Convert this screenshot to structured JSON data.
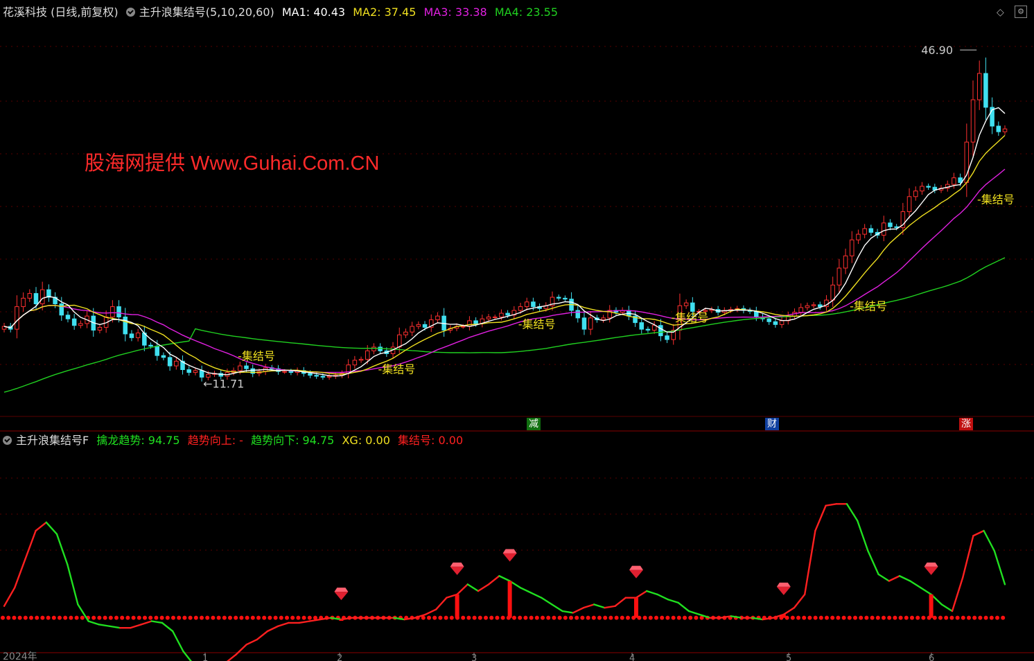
{
  "header": {
    "title": "花溪科技 (日线,前复权)",
    "indicator_name": "主升浪集结号(5,10,20,60)",
    "ma": [
      {
        "label": "MA1: 40.43",
        "color": "#ffffff"
      },
      {
        "label": "MA2: 37.45",
        "color": "#f0e020"
      },
      {
        "label": "MA3: 33.38",
        "color": "#e020e0"
      },
      {
        "label": "MA4: 23.55",
        "color": "#20d020"
      }
    ]
  },
  "watermark": "股海网提供 Www.Guhai.Com.CN",
  "sub_header": {
    "name": "主升浪集结号F",
    "items": [
      {
        "label": "擒龙趋势: 94.75",
        "color": "#20e020"
      },
      {
        "label": "趋势向上: -",
        "color": "#ff2020"
      },
      {
        "label": "趋势向下: 94.75",
        "color": "#20e020"
      },
      {
        "label": "XG: 0.00",
        "color": "#f0e020"
      },
      {
        "label": "集结号: 0.00",
        "color": "#ff2020"
      }
    ]
  },
  "annotations": {
    "high_label": "46.90",
    "low_label": "11.71",
    "signal_text": "集结号",
    "event_tags": [
      {
        "text": "减",
        "bg": "#107010",
        "color": "#ffffff"
      },
      {
        "text": "财",
        "bg": "#1040a0",
        "color": "#ffffff"
      },
      {
        "text": "涨",
        "bg": "#c01010",
        "color": "#ffffff"
      }
    ]
  },
  "x_axis": {
    "year_label": "2024年",
    "month_labels": [
      "1",
      "2",
      "3",
      "4",
      "5",
      "6"
    ]
  },
  "icons": [
    "diamond-icon",
    "settings-icon"
  ],
  "chart_data": {
    "type": "candlestick",
    "main_panel": {
      "price_ylim": [
        8,
        50
      ],
      "high": 46.9,
      "low": 11.71,
      "ma_last": {
        "MA1": 40.43,
        "MA2": 37.45,
        "MA3": 33.38,
        "MA4": 23.55
      },
      "close": [
        17.5,
        17.2,
        19.6,
        20.5,
        21.0,
        19.9,
        21.4,
        20.6,
        19.9,
        18.7,
        18.3,
        17.6,
        17.8,
        18.6,
        17.1,
        17.4,
        18.5,
        19.6,
        18.5,
        16.7,
        16.3,
        16.8,
        15.5,
        15.4,
        14.4,
        14.2,
        13.3,
        13.8,
        12.9,
        12.6,
        12.8,
        12.1,
        12.4,
        12.5,
        12.2,
        12.6,
        12.8,
        13.3,
        13.0,
        12.5,
        12.7,
        13.1,
        13.0,
        12.7,
        12.7,
        12.6,
        12.8,
        12.5,
        12.3,
        12.2,
        12.1,
        12.2,
        12.3,
        12.5,
        13.4,
        13.9,
        14.0,
        14.9,
        15.3,
        14.9,
        14.6,
        15.3,
        16.6,
        16.9,
        17.5,
        17.7,
        17.4,
        18.2,
        18.6,
        17.1,
        17.3,
        17.5,
        17.5,
        18.1,
        17.8,
        18.3,
        18.5,
        18.5,
        18.9,
        18.7,
        19.2,
        19.6,
        20.1,
        19.6,
        19.4,
        19.7,
        20.6,
        20.5,
        20.4,
        19.2,
        18.4,
        17.2,
        18.4,
        18.2,
        18.4,
        19.2,
        19.0,
        19.2,
        18.6,
        17.9,
        17.2,
        17.1,
        17.6,
        16.5,
        16.1,
        17.1,
        19.7,
        20.0,
        19.1,
        19.1,
        19.2,
        19.3,
        19.0,
        19.2,
        19.3,
        19.4,
        19.2,
        19.1,
        18.5,
        18.3,
        18.0,
        17.7,
        18.1,
        18.6,
        19.0,
        19.5,
        19.7,
        19.8,
        19.6,
        20.3,
        21.9,
        23.7,
        25.0,
        26.7,
        27.3,
        27.9,
        27.5,
        27.2,
        28.5,
        28.1,
        28.0,
        29.7,
        31.3,
        31.9,
        32.4,
        32.3,
        32.0,
        32.2,
        32.6,
        33.3,
        32.8,
        37.1,
        41.6,
        44.4,
        40.8,
        38.8,
        38.2,
        38.5
      ]
    },
    "sub_panel": {
      "ylim": [
        -20,
        100
      ],
      "baseline": 0,
      "series": [
        {
          "name": "擒龙趋势",
          "values": [
            7,
            18,
            35,
            52,
            57,
            50,
            32,
            8,
            -2,
            -4,
            -5,
            -6,
            -6,
            -4,
            -2,
            -3,
            -8,
            -20,
            -28,
            -34,
            -31,
            -27,
            -22,
            -16,
            -13,
            -8,
            -5,
            -3,
            -3,
            -2,
            -1,
            0,
            -1,
            0,
            0,
            0,
            0,
            0,
            -1,
            0,
            2,
            5,
            12,
            14,
            20,
            16,
            20,
            25,
            22,
            18,
            15,
            12,
            8,
            4,
            3,
            6,
            8,
            6,
            7,
            12,
            12,
            16,
            14,
            11,
            9,
            4,
            2,
            0,
            0,
            1,
            0,
            0,
            -1,
            0,
            2,
            6,
            14,
            52,
            67,
            68,
            68,
            58,
            40,
            26,
            22,
            25,
            22,
            18,
            14,
            8,
            4,
            24,
            49,
            52,
            40,
            20
          ]
        },
        {
          "name": "XG",
          "values": [
            0,
            0,
            0,
            0,
            0,
            0,
            0,
            0,
            0,
            0,
            0,
            0,
            0,
            0,
            0,
            0,
            0,
            0,
            0,
            0,
            0,
            0,
            0,
            0,
            0,
            0,
            0,
            0,
            0,
            0,
            0,
            0,
            0,
            0,
            0,
            0,
            0,
            0,
            0,
            0,
            0,
            0,
            0,
            0,
            0,
            0,
            0,
            0,
            0,
            0,
            0,
            0,
            0,
            0,
            0,
            0,
            0,
            0,
            0,
            0,
            0,
            0,
            0,
            0,
            0,
            0,
            0,
            0,
            0,
            0,
            0,
            0,
            0,
            0,
            0,
            0,
            0,
            0,
            0,
            0,
            0,
            0,
            0,
            0,
            0,
            0,
            0,
            0,
            0,
            0,
            0,
            0,
            0,
            0,
            0,
            0,
            0,
            0
          ]
        }
      ]
    }
  }
}
